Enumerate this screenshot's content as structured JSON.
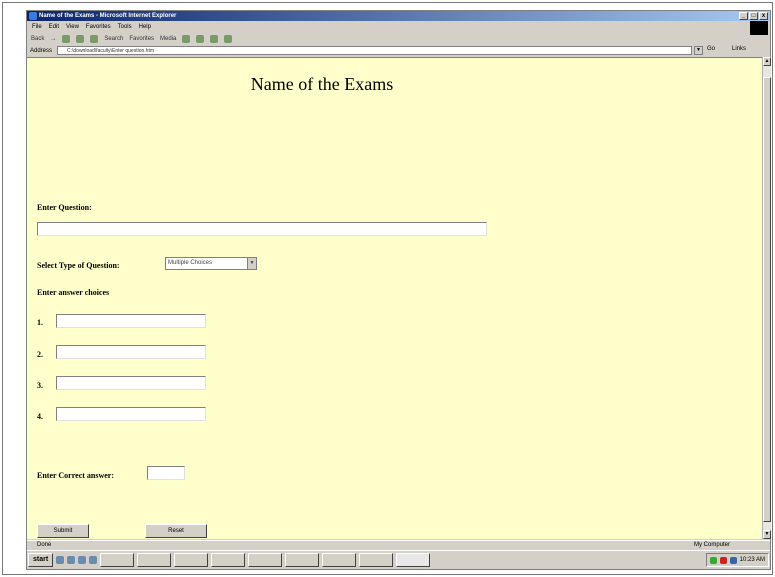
{
  "window": {
    "title": "Name of the Exams - Microsoft Internet Explorer",
    "minimize": "_",
    "maximize": "□",
    "close": "x"
  },
  "menu": [
    "File",
    "Edit",
    "View",
    "Favorites",
    "Tools",
    "Help"
  ],
  "toolbar": {
    "back": "Back",
    "forward": "→",
    "search": "Search",
    "favorites": "Favorites",
    "media": "Media"
  },
  "address": {
    "label": "Address",
    "value": "C:\\download\\faculty\\Enter question.htm",
    "go": "Go",
    "links": "Links"
  },
  "page": {
    "title": "Name of the Exams",
    "enter_question_label": "Enter Question:",
    "question_value": "",
    "select_type_label": "Select Type of  Question:",
    "select_type_value": "Multiple Choices",
    "answer_choices_label": "Enter answer choices",
    "choices": [
      {
        "number": "1.",
        "value": ""
      },
      {
        "number": "2.",
        "value": ""
      },
      {
        "number": "3.",
        "value": ""
      },
      {
        "number": "4.",
        "value": ""
      }
    ],
    "correct_answer_label": "Enter Correct answer:",
    "correct_answer_value": "",
    "submit_label": "Submit",
    "reset_label": "Reset"
  },
  "status": {
    "text": "Done",
    "zone": "My Computer"
  },
  "taskbar": {
    "start": "start",
    "time": "10:23 AM"
  }
}
